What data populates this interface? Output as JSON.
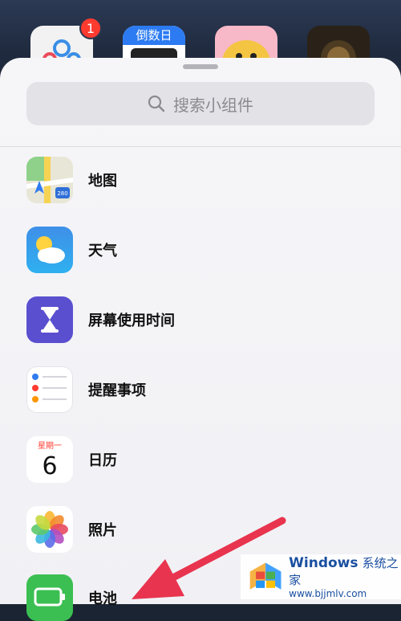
{
  "home": {
    "badge_count": "1",
    "countdown_label": "倒数日"
  },
  "search": {
    "placeholder": "搜索小组件",
    "icon": "magnifier-icon"
  },
  "widgets": [
    {
      "label": "地图",
      "icon": "maps-icon",
      "map_sign": "280"
    },
    {
      "label": "天气",
      "icon": "weather-icon"
    },
    {
      "label": "屏幕使用时间",
      "icon": "hourglass-icon"
    },
    {
      "label": "提醒事项",
      "icon": "reminders-icon"
    },
    {
      "label": "日历",
      "icon": "calendar-icon",
      "weekday": "星期一",
      "day": "6"
    },
    {
      "label": "照片",
      "icon": "photos-icon"
    },
    {
      "label": "电池",
      "icon": "battery-icon"
    }
  ],
  "watermark": {
    "brand": "Windows",
    "brand_cn": "系统之家",
    "url": "www.bjjmlv.com"
  },
  "colors": {
    "accent_arrow": "#e8344e",
    "sheet_bg": "#f3f3f7",
    "badge": "#ff3b30"
  }
}
